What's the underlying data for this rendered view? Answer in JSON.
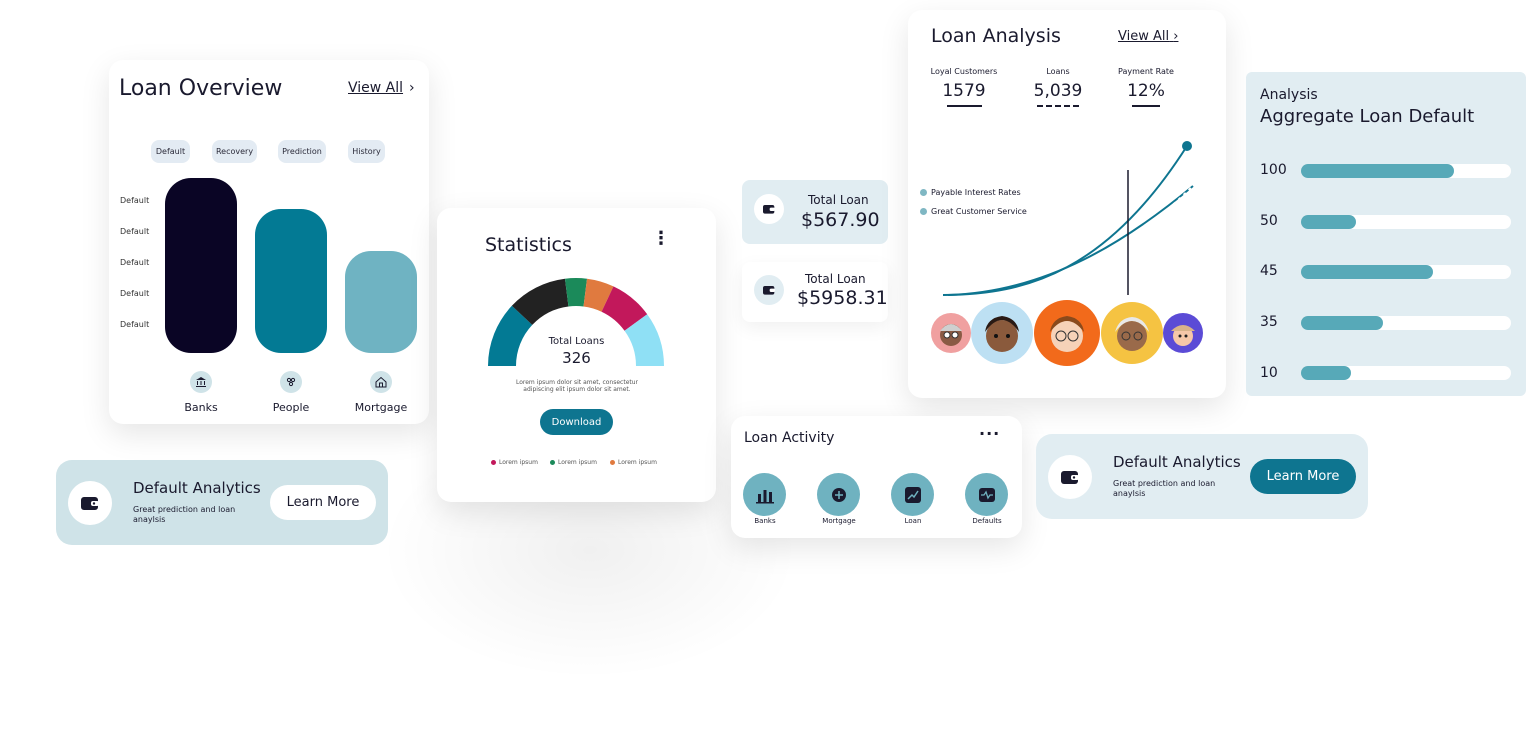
{
  "colors": {
    "navy": "#0a0525",
    "teal": "#037a94",
    "light_teal": "#6fb3c2",
    "pale": "#cfe3e8",
    "button_teal": "#0e7590"
  },
  "overview": {
    "title": "Loan Overview",
    "view_all": "View All",
    "tabs": [
      "Default",
      "Recovery",
      "Prediction",
      "History"
    ],
    "y_labels": [
      "Default",
      "Default",
      "Default",
      "Default",
      "Default"
    ],
    "bars": [
      {
        "label": "Banks",
        "icon": "bank-icon",
        "value": 1.0,
        "color": "#0a0525"
      },
      {
        "label": "People",
        "icon": "people-icon",
        "value": 0.82,
        "color": "#037a94"
      },
      {
        "label": "Mortgage",
        "icon": "house-icon",
        "value": 0.58,
        "color": "#6fb3c2"
      }
    ]
  },
  "default_analytics_left": {
    "title": "Default Analytics",
    "subtitle": "Great prediction and loan anaylsis",
    "button": "Learn More",
    "icon": "wallet-icon"
  },
  "statistics": {
    "title": "Statistics",
    "menu_icon": "more-vertical-icon",
    "center_label": "Total Loans",
    "center_value": "326",
    "description": "Lorem ipsum dolor sit amet, consectetur adipiscing elit ipsum dolor sit amet.",
    "download_button": "Download",
    "legend": [
      {
        "label": "Lorem ipsum",
        "color": "#c2185b"
      },
      {
        "label": "Lorem ipsum",
        "color": "#1b8a5a"
      },
      {
        "label": "Lorem ipsum",
        "color": "#e07a3f"
      }
    ],
    "segments": [
      {
        "color": "#037a94",
        "value": 24
      },
      {
        "color": "#222222",
        "value": 22
      },
      {
        "color": "#1b8a5a",
        "value": 8
      },
      {
        "color": "#e07a3f",
        "value": 10
      },
      {
        "color": "#c2185b",
        "value": 16
      },
      {
        "color": "#8fe0f5",
        "value": 20
      }
    ]
  },
  "total_loan_1": {
    "label": "Total Loan",
    "value": "$567.90",
    "icon": "wallet-icon"
  },
  "total_loan_2": {
    "label": "Total Loan",
    "value": "$5958.31",
    "icon": "wallet-icon"
  },
  "analysis": {
    "title": "Loan Analysis",
    "view_all": "View All",
    "stats": [
      {
        "label": "Loyal Customers",
        "value": "1579"
      },
      {
        "label": "Loans",
        "value": "5,039"
      },
      {
        "label": "Payment Rate",
        "value": "12%"
      }
    ],
    "legend": [
      "Payable Interest Rates",
      "Great Customer Service"
    ],
    "avatar_colors": [
      "#f0a0a0",
      "#bde0f3",
      "#f26a1b",
      "#f5c342",
      "#5b4bd6"
    ]
  },
  "activity": {
    "title": "Loan Activity",
    "menu_icon": "more-horizontal-icon",
    "items": [
      {
        "label": "Banks",
        "icon": "bar-chart-icon"
      },
      {
        "label": "Mortgage",
        "icon": "coin-icon"
      },
      {
        "label": "Loan",
        "icon": "trend-up-icon"
      },
      {
        "label": "Defaults",
        "icon": "pulse-icon"
      }
    ]
  },
  "default_analytics_right": {
    "title": "Default Analytics",
    "subtitle": "Great prediction and loan anaylsis",
    "button": "Learn More",
    "icon": "wallet-icon"
  },
  "aggregate": {
    "subtitle": "Analysis",
    "title": "Aggregate Loan Default",
    "rows": [
      {
        "label": "100",
        "fill": 0.73
      },
      {
        "label": "50",
        "fill": 0.26
      },
      {
        "label": "45",
        "fill": 0.63
      },
      {
        "label": "35",
        "fill": 0.39
      },
      {
        "label": "10",
        "fill": 0.24
      }
    ]
  }
}
